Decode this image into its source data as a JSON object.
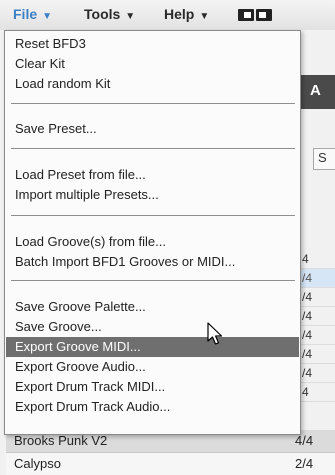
{
  "menubar": {
    "items": [
      {
        "label": "File",
        "arrow": "▼"
      },
      {
        "label": "Tools",
        "arrow": "▼"
      },
      {
        "label": "Help",
        "arrow": "▼"
      }
    ],
    "active_color": "#3b7fc7"
  },
  "background": {
    "header_letter": "A",
    "button_letter": "S",
    "grid_cells": [
      "4",
      "/4",
      "/4",
      "/4",
      "/4",
      "/4",
      "/4",
      "4"
    ],
    "rows": [
      {
        "name": "Brooks Punk V2",
        "sig": "4/4"
      },
      {
        "name": "Calypso",
        "sig": "2/4"
      }
    ]
  },
  "menu": {
    "items": [
      "Reset BFD3",
      "Clear Kit",
      "Load random Kit",
      "Save Preset...",
      "Load Preset from file...",
      "Import multiple Presets...",
      "Load Groove(s) from file...",
      "Batch Import BFD1 Grooves or MIDI...",
      "Save Groove Palette...",
      "Save Groove...",
      "Export Groove MIDI...",
      "Export Groove Audio...",
      "Export Drum Track MIDI...",
      "Export Drum Track Audio..."
    ],
    "highlighted": "Export Groove MIDI..."
  }
}
